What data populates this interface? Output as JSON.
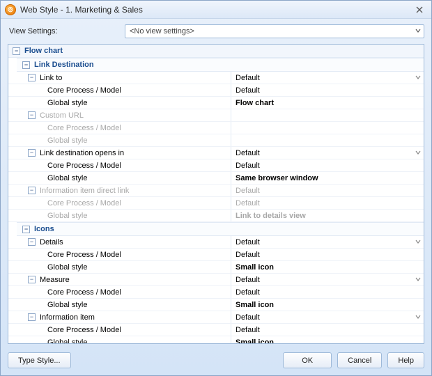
{
  "title": "Web Style - 1. Marketing & Sales",
  "viewSettings": {
    "label": "View Settings:",
    "value": "<No view settings>"
  },
  "tree": {
    "root": {
      "label": "Flow chart"
    },
    "sections": [
      {
        "label": "Link Destination",
        "rows": [
          {
            "name": "Link to",
            "value": "Default",
            "dropdown": true,
            "disabled": false,
            "children": [
              {
                "name": "Core Process / Model",
                "value": "Default"
              },
              {
                "name": "Global style",
                "value": "Flow chart",
                "bold": true
              }
            ]
          },
          {
            "name": "Custom URL",
            "value": "",
            "disabled": true,
            "children": [
              {
                "name": "Core Process / Model",
                "value": "",
                "disabled": true
              },
              {
                "name": "Global style",
                "value": "",
                "disabled": true
              }
            ]
          },
          {
            "name": "Link destination opens in",
            "value": "Default",
            "dropdown": true,
            "disabled": false,
            "children": [
              {
                "name": "Core Process / Model",
                "value": "Default"
              },
              {
                "name": "Global style",
                "value": "Same browser window",
                "bold": true
              }
            ]
          },
          {
            "name": "Information item direct link",
            "value": "Default",
            "disabled": true,
            "children": [
              {
                "name": "Core Process / Model",
                "value": "Default",
                "disabled": true
              },
              {
                "name": "Global style",
                "value": "Link to details view",
                "disabled": true,
                "bold": true
              }
            ]
          }
        ]
      },
      {
        "label": "Icons",
        "rows": [
          {
            "name": "Details",
            "value": "Default",
            "dropdown": true,
            "children": [
              {
                "name": "Core Process / Model",
                "value": "Default"
              },
              {
                "name": "Global style",
                "value": "Small icon",
                "bold": true
              }
            ]
          },
          {
            "name": "Measure",
            "value": "Default",
            "dropdown": true,
            "children": [
              {
                "name": "Core Process / Model",
                "value": "Default"
              },
              {
                "name": "Global style",
                "value": "Small icon",
                "bold": true
              }
            ]
          },
          {
            "name": "Information item",
            "value": "Default",
            "dropdown": true,
            "children": [
              {
                "name": "Core Process / Model",
                "value": "Default"
              },
              {
                "name": "Global style",
                "value": "Small icon",
                "bold": true
              }
            ]
          }
        ]
      }
    ]
  },
  "footer": {
    "typeStyle": "Type Style...",
    "ok": "OK",
    "cancel": "Cancel",
    "help": "Help"
  }
}
